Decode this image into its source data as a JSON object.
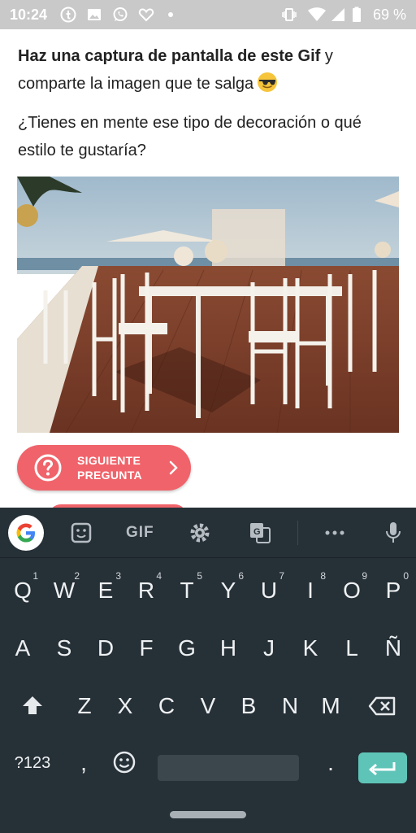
{
  "status_bar": {
    "time": "10:24",
    "battery_pct": "69 %",
    "left_icons": [
      "tumblr-icon",
      "image-icon",
      "whatsapp-icon",
      "heart-app-icon",
      "dot-icon"
    ],
    "right_icons": [
      "vibrate-icon",
      "wifi-icon",
      "signal-icon",
      "battery-icon"
    ]
  },
  "post": {
    "para1_bold1": "Haz una captura de pantalla de este Gif",
    "para1_rest": " y comparte la imagen que te salga",
    "para2": "¿Tienes en mente ese tipo de decoración o qué estilo te gustaría?",
    "emoji": "sunglasses-emoji"
  },
  "next_button": {
    "line1": "SIGUIENTE",
    "line2": "PREGUNTA",
    "color": "#f0636a"
  },
  "keyboard": {
    "toolbar": {
      "gif_label": "GIF",
      "icons": [
        "google-icon",
        "sticker-icon",
        "gif-icon",
        "settings-icon",
        "translate-icon",
        "more-icon",
        "mic-icon"
      ]
    },
    "row1": [
      {
        "k": "Q",
        "n": "1"
      },
      {
        "k": "W",
        "n": "2"
      },
      {
        "k": "E",
        "n": "3"
      },
      {
        "k": "R",
        "n": "4"
      },
      {
        "k": "T",
        "n": "5"
      },
      {
        "k": "Y",
        "n": "6"
      },
      {
        "k": "U",
        "n": "7"
      },
      {
        "k": "I",
        "n": "8"
      },
      {
        "k": "O",
        "n": "9"
      },
      {
        "k": "P",
        "n": "0"
      }
    ],
    "row2": [
      "A",
      "S",
      "D",
      "F",
      "G",
      "H",
      "J",
      "K",
      "L",
      "Ñ"
    ],
    "row3": [
      "Z",
      "X",
      "C",
      "V",
      "B",
      "N",
      "M"
    ],
    "sym_label": "?123",
    "comma": ",",
    "period": ".",
    "accent": "#5fc4b8",
    "background": "#263037"
  }
}
